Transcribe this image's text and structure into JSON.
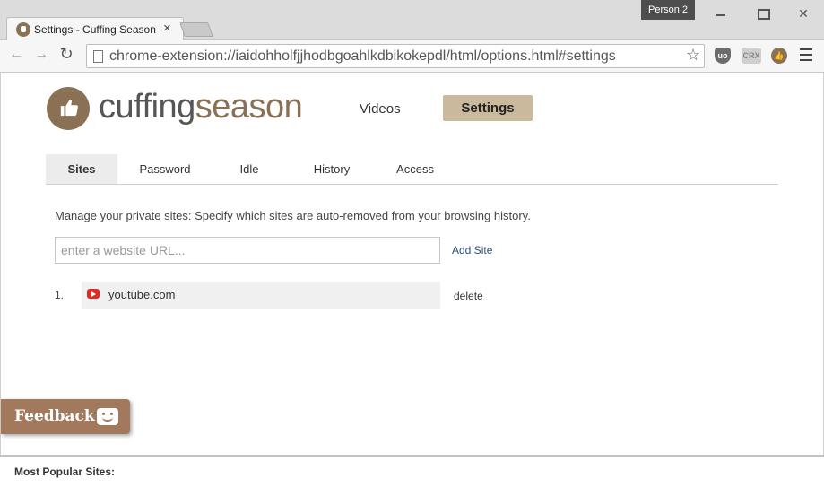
{
  "browser": {
    "tab_title": "Settings - Cuffing Season",
    "profile": "Person 2",
    "url": "chrome-extension://iaidohholfjjhodbgoahlkdbikokepdl/html/options.html#settings",
    "extensions": [
      "ublock-icon",
      "CRX",
      "cuffing-season-icon"
    ]
  },
  "brand": {
    "part1": "cuffing",
    "part2": "season",
    "accent": "#8a7156"
  },
  "topnav": {
    "videos": "Videos",
    "settings": "Settings"
  },
  "subtabs": [
    "Sites",
    "Password",
    "Idle",
    "History",
    "Access"
  ],
  "sites_panel": {
    "description": "Manage your private sites: Specify which sites are auto-removed from your browsing history.",
    "input_placeholder": "enter a website URL...",
    "add_label": "Add Site",
    "items": [
      {
        "number": "1.",
        "name": "youtube.com",
        "delete_label": "delete"
      }
    ]
  },
  "feedback": {
    "label": "Feedback"
  },
  "popular": {
    "title": "Most Popular Sites:"
  }
}
